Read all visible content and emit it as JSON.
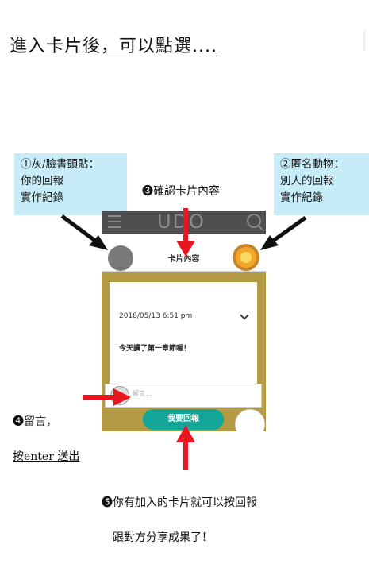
{
  "title": "進入卡片後，可以點選....",
  "callouts": {
    "left": "①灰/臉書頭貼：\n你的回報\n實作紀錄",
    "right": "②匿名動物：\n別人的回報\n實作紀錄"
  },
  "captions": {
    "confirm": "❸確認卡片內容",
    "comment_line1": "❹留言，",
    "comment_line2": "按enter 送出",
    "report_line1": "❺你有加入的卡片就可以按回報",
    "report_line2": "跟對方分享成果了！"
  },
  "phone": {
    "logo": "UDO",
    "header_title": "卡片內容",
    "card_date": "2018/05/13 6:51 pm",
    "card_text": "今天讀了第一章節喔！",
    "comment_placeholder": "留言...",
    "report_button": "我要回報"
  },
  "colors": {
    "callout_bg": "#c7ecf7",
    "arrow_red": "#e8171f",
    "card_gold": "#b59a45",
    "button_teal": "#13a596"
  }
}
